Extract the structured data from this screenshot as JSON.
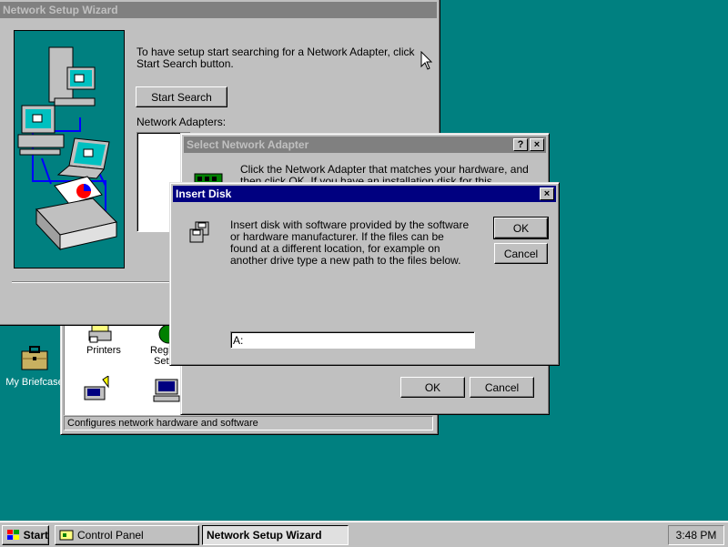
{
  "desktop": {
    "briefcase_label": "My Briefcase"
  },
  "control_panel": {
    "items": {
      "printers": "Printers",
      "regional_1": "Regi",
      "regional_2": "Setti"
    },
    "status_text": "Configures network hardware and software"
  },
  "wizard": {
    "title": "Network Setup Wizard",
    "instruction": "To have setup start searching for a Network Adapter, click Start Search button.",
    "start_search_label": "Start Search",
    "adapters_label": "Network Adapters:"
  },
  "select_adapter": {
    "title": "Select Network Adapter",
    "help_button": "?",
    "close_button": "×",
    "instruction": "Click the Network Adapter that matches your hardware, and then click OK.  If you have an installation disk for this component, click",
    "ok_label": "OK",
    "cancel_label": "Cancel"
  },
  "insert_disk": {
    "title": "Insert Disk",
    "close_button": "×",
    "message": "Insert disk with software provided by the software or hardware manufacturer.  If the files can be found at a different location, for example on another drive type a new path to the files below.",
    "path_value": "A:",
    "ok_label": "OK",
    "cancel_label": "Cancel"
  },
  "taskbar": {
    "start_label": "Start",
    "tasks": [
      {
        "label": "Control Panel"
      },
      {
        "label": "Network Setup Wizard"
      }
    ],
    "clock": "3:48 PM"
  }
}
